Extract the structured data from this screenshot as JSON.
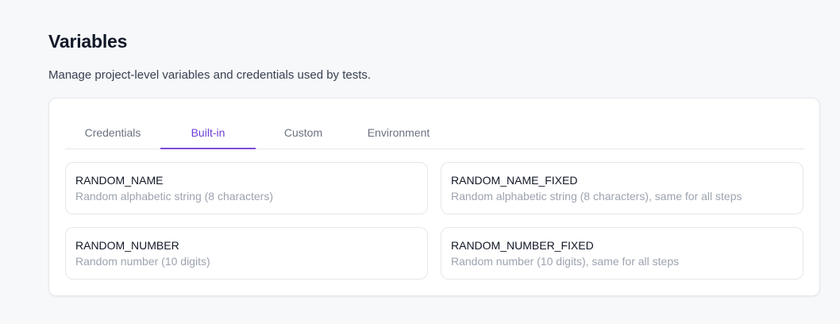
{
  "header": {
    "title": "Variables",
    "subtitle": "Manage project-level variables and credentials used by tests."
  },
  "tabs": [
    {
      "label": "Credentials",
      "active": false
    },
    {
      "label": "Built-in",
      "active": true
    },
    {
      "label": "Custom",
      "active": false
    },
    {
      "label": "Environment",
      "active": false
    }
  ],
  "variables": [
    {
      "name": "RANDOM_NAME",
      "description": "Random alphabetic string (8 characters)"
    },
    {
      "name": "RANDOM_NAME_FIXED",
      "description": "Random alphabetic string (8 characters), same for all steps"
    },
    {
      "name": "RANDOM_NUMBER",
      "description": "Random number (10 digits)"
    },
    {
      "name": "RANDOM_NUMBER_FIXED",
      "description": "Random number (10 digits), same for all steps"
    }
  ],
  "colors": {
    "accent": "#7c4ddb",
    "background": "#f7f8fa",
    "muted_text": "#9ca3af"
  }
}
